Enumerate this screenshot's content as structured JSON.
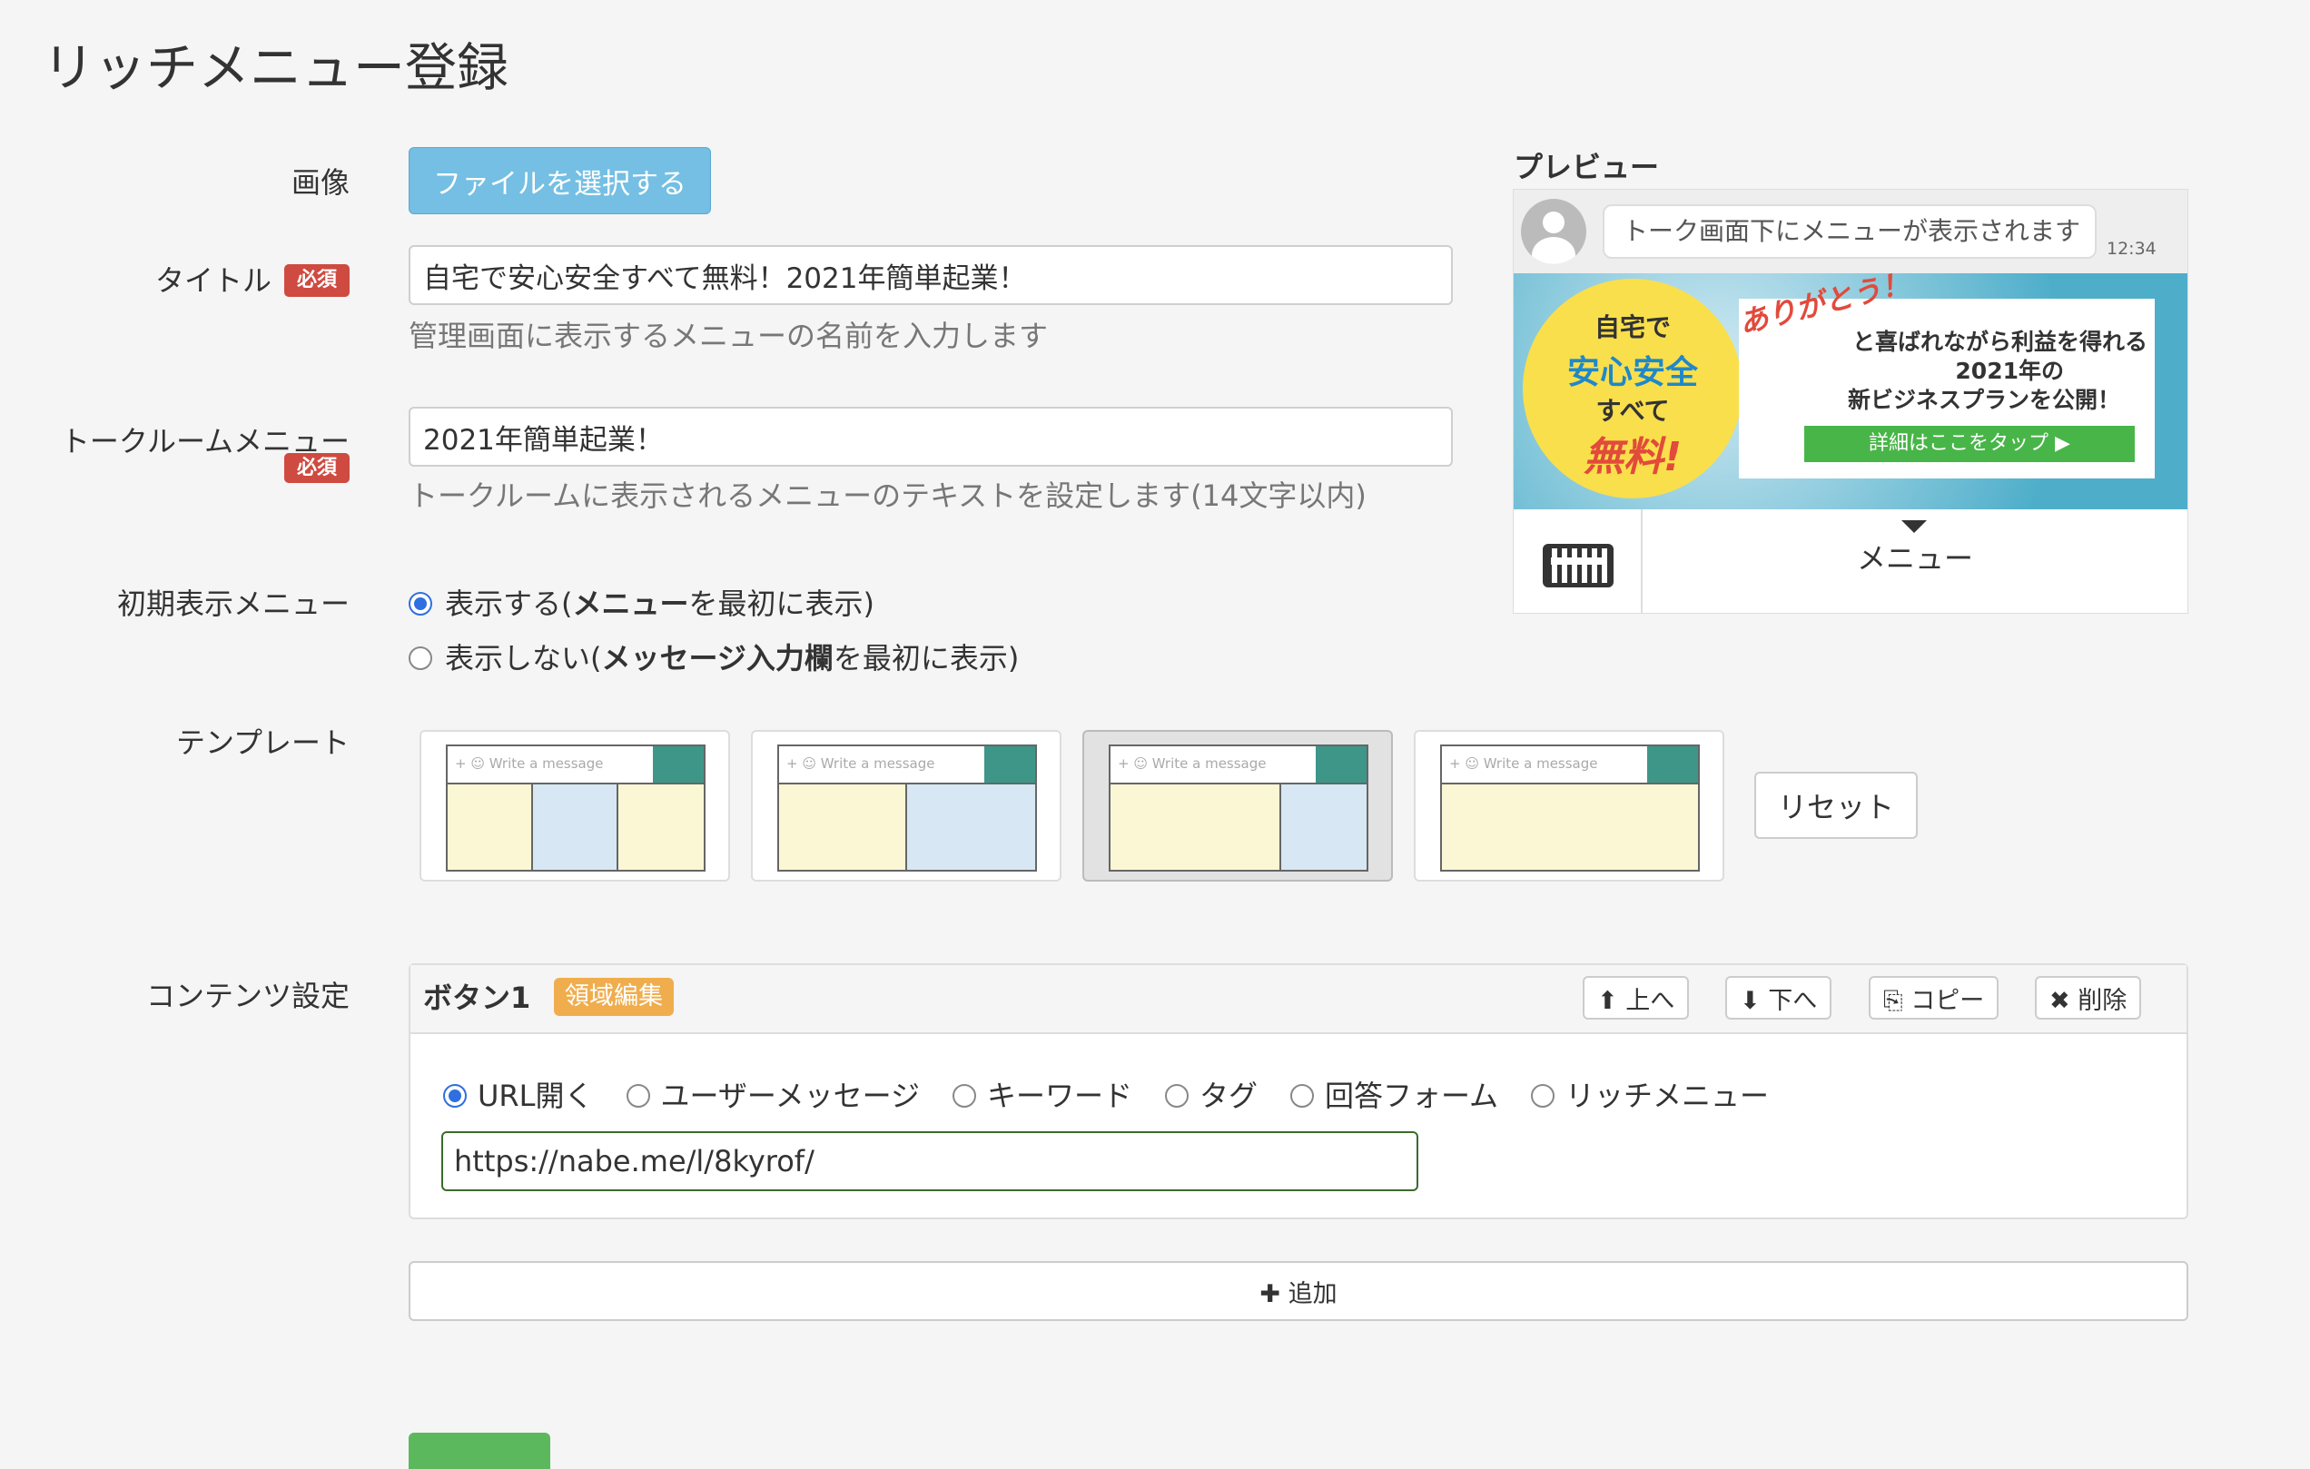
{
  "page_title": "リッチメニュー登録",
  "labels": {
    "image": "画像",
    "title": "タイトル",
    "talkroom_menu": "トークルームメニュー",
    "initial_menu": "初期表示メニュー",
    "template": "テンプレート",
    "contents": "コンテンツ設定"
  },
  "required_badge": "必須",
  "file_button": "ファイルを選択する",
  "title_field": {
    "value": "自宅で安心安全すべて無料！2021年簡単起業！",
    "help": "管理画面に表示するメニューの名前を入力します"
  },
  "talkroom_field": {
    "value": "2021年簡単起業！",
    "help": "トークルームに表示されるメニューのテキストを設定します(14文字以内)"
  },
  "initial_options": [
    {
      "pre": "表示する(",
      "bold": "メニュー",
      "post": "を最初に表示)",
      "selected": true
    },
    {
      "pre": "表示しない(",
      "bold": "メッセージ入力欄",
      "post": "を最初に表示)",
      "selected": false
    }
  ],
  "template_placeholder": "Write a message",
  "reset_button": "リセット",
  "content_panel": {
    "button_name": "ボタン1",
    "edit_area_badge": "領域編集",
    "up_button": "上へ",
    "down_button": "下へ",
    "copy_button": "コピー",
    "delete_button": "削除",
    "action_options": [
      "URL開く",
      "ユーザーメッセージ",
      "キーワード",
      "タグ",
      "回答フォーム",
      "リッチメニュー"
    ],
    "selected_action": "URL開く",
    "url_value": "https://nabe.me/l/8kyrof/"
  },
  "add_button": "追加",
  "preview": {
    "label": "プレビュー",
    "bubble_text": "トーク画面下にメニューが表示されます",
    "time": "12:34",
    "banner": {
      "circle_line1": "自宅で",
      "circle_line2": "安心安全",
      "circle_line3": "すべて",
      "circle_line4": "無料!",
      "arigato": "ありがとう！",
      "line1": "と喜ばれながら利益を得れる",
      "line2": "2021年の",
      "line3": "新ビジネスプランを公開！",
      "detail_button": "詳細はここをタップ ▶"
    },
    "menu_label": "メニュー"
  },
  "colors": {
    "file_button": "#74bfe3",
    "required_badge": "#cf4a40",
    "edit_badge": "#f0ad4e",
    "radio_selected": "#2f6fe0",
    "template_teal": "#3d9688",
    "template_yellow": "#fbf7d4",
    "template_blue": "#d7e8f4"
  }
}
